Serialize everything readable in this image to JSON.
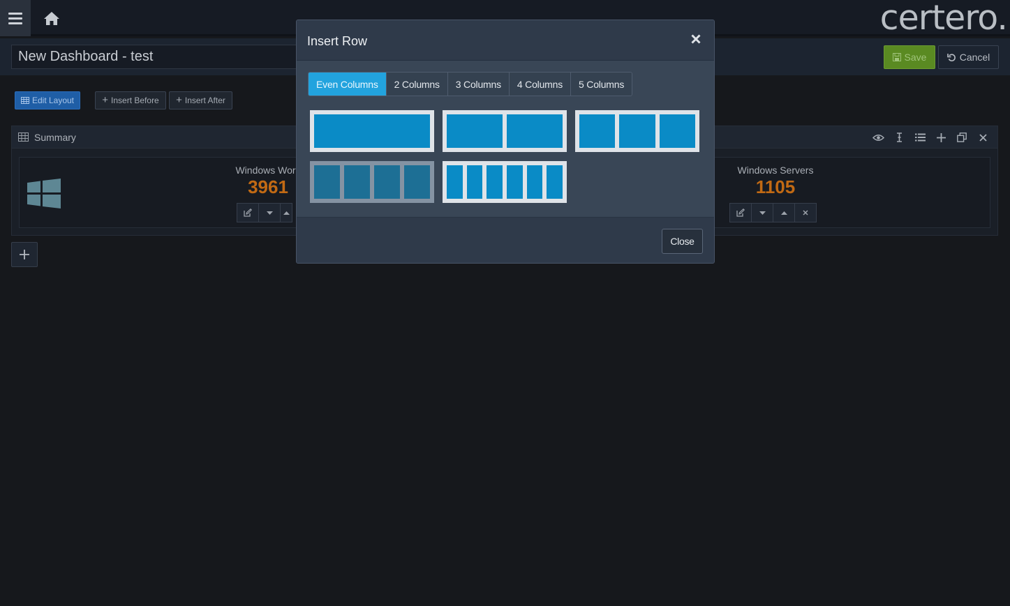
{
  "header": {
    "brand": "certero."
  },
  "toolbar": {
    "dashboard_title": "New Dashboard - test",
    "save_label": "Save",
    "cancel_label": "Cancel"
  },
  "layout_controls": {
    "edit_layout": "Edit Layout",
    "insert_before": "Insert Before",
    "insert_after": "Insert After"
  },
  "panel": {
    "title": "Summary",
    "widgets": [
      {
        "label": "Windows Work",
        "value": "3961"
      },
      {
        "label": "Windows Servers",
        "value": "1105"
      }
    ]
  },
  "modal": {
    "title": "Insert Row",
    "close_label": "Close",
    "tabs": [
      {
        "label": "Even Columns",
        "active": true
      },
      {
        "label": "2 Columns",
        "active": false
      },
      {
        "label": "3 Columns",
        "active": false
      },
      {
        "label": "4 Columns",
        "active": false
      },
      {
        "label": "5 Columns",
        "active": false
      }
    ],
    "layouts": [
      {
        "columns": 1,
        "selected": false
      },
      {
        "columns": 2,
        "selected": false
      },
      {
        "columns": 3,
        "selected": false
      },
      {
        "columns": 4,
        "selected": true
      },
      {
        "columns": 6,
        "selected": false
      }
    ]
  },
  "colors": {
    "accent_tab": "#22a3de",
    "column_fill": "#0a8bc6",
    "value_orange": "#c26a14",
    "save_green": "#5a8a22",
    "edit_blue": "#1f5ea6"
  },
  "icons": [
    "menu-icon",
    "home-icon",
    "save-icon",
    "undo-icon",
    "grid-icon",
    "plus-icon",
    "eye-icon",
    "text-cursor-icon",
    "list-icon",
    "copy-icon",
    "close-icon",
    "windows-logo-icon",
    "edit-icon",
    "caret-down-icon",
    "caret-up-icon"
  ]
}
